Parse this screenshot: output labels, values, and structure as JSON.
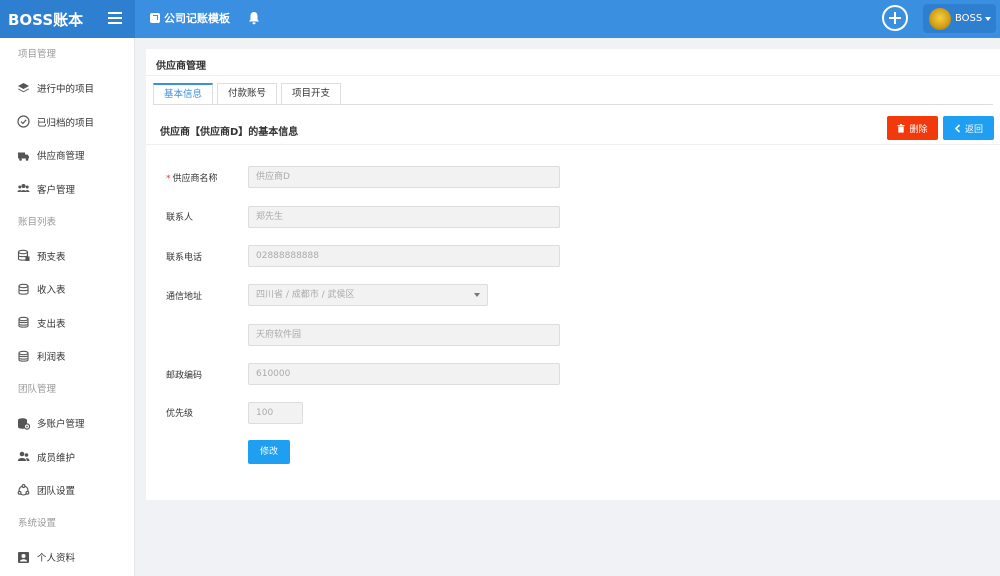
{
  "brand": {
    "title": "BOSS账本"
  },
  "topbar": {
    "link_label": "公司记账模板"
  },
  "user": {
    "name": "BOSS"
  },
  "sidebar": {
    "items": [
      {
        "type": "group",
        "label": "项目管理"
      },
      {
        "type": "item",
        "label": "进行中的项目",
        "icon": "layers-icon"
      },
      {
        "type": "item",
        "label": "已归档的项目",
        "icon": "check-circle-icon"
      },
      {
        "type": "item",
        "label": "供应商管理",
        "icon": "truck-icon"
      },
      {
        "type": "item",
        "label": "客户管理",
        "icon": "users-icon"
      },
      {
        "type": "group",
        "label": "账目列表"
      },
      {
        "type": "item",
        "label": "预支表",
        "icon": "database-icon"
      },
      {
        "type": "item",
        "label": "收入表",
        "icon": "database-icon"
      },
      {
        "type": "item",
        "label": "支出表",
        "icon": "database-icon"
      },
      {
        "type": "item",
        "label": "利润表",
        "icon": "database-icon"
      },
      {
        "type": "group",
        "label": "团队管理"
      },
      {
        "type": "item",
        "label": "多账户管理",
        "icon": "database-gear-icon"
      },
      {
        "type": "item",
        "label": "成员维护",
        "icon": "user-group-icon"
      },
      {
        "type": "item",
        "label": "团队设置",
        "icon": "team-icon"
      },
      {
        "type": "group",
        "label": "系统设置"
      },
      {
        "type": "item",
        "label": "个人资料",
        "icon": "profile-icon"
      }
    ]
  },
  "panel": {
    "title": "供应商管理",
    "tabs": [
      {
        "label": "基本信息",
        "active": true
      },
      {
        "label": "付款账号",
        "active": false
      },
      {
        "label": "项目开支",
        "active": false
      }
    ],
    "section_title": "供应商【供应商D】的基本信息",
    "delete_label": "删除",
    "back_label": "返回",
    "edit_label": "修改"
  },
  "form": {
    "name_label": "供应商名称",
    "name_value": "供应商D",
    "contact_label": "联系人",
    "contact_value": "郑先生",
    "phone_label": "联系电话",
    "phone_value": "02888888888",
    "address_label": "通信地址",
    "region_value": "四川省 / 成都市 / 武侯区",
    "street_value": "天府软件园",
    "postcode_label": "邮政编码",
    "postcode_value": "610000",
    "priority_label": "优先级",
    "priority_value": "100"
  },
  "colors": {
    "primary": "#3b8fe0",
    "danger": "#f2390c",
    "button_blue": "#1e9ff2"
  }
}
